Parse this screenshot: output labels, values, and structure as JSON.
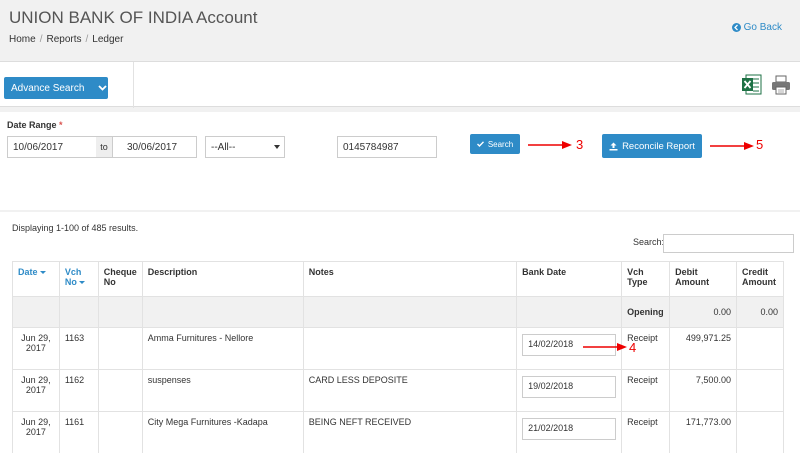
{
  "header": {
    "title": "UNION BANK OF INDIA Account",
    "breadcrumb": [
      "Home",
      "Reports",
      "Ledger"
    ],
    "go_back": "Go Back"
  },
  "toolbar": {
    "advance_search": "Advance Search",
    "excel_icon": "excel-export-icon",
    "print_icon": "printer-icon"
  },
  "filters": {
    "date_range_label": "Date Range",
    "required_mark": "*",
    "date_from": "10/06/2017",
    "to_label": "to",
    "date_to": "30/06/2017",
    "type_select": "--All--",
    "account_no": "0145784987",
    "search_button": "Search",
    "reconcile_button": "Reconcile Report"
  },
  "annotations": {
    "search_marker": "3",
    "reconcile_marker": "5",
    "bank_date_marker": "4"
  },
  "results": {
    "count_text": "Displaying 1-100 of 485 results.",
    "search_label": "Search:",
    "search_value": ""
  },
  "table": {
    "columns": {
      "date": "Date",
      "vch_no_line1": "Vch",
      "vch_no_line2": "No",
      "cheque_line1": "Cheque",
      "cheque_line2": "No",
      "description": "Description",
      "notes": "Notes",
      "bank_date": "Bank Date",
      "vch_type_line1": "Vch",
      "vch_type_line2": "Type",
      "debit_line1": "Debit",
      "debit_line2": "Amount",
      "credit_line1": "Credit",
      "credit_line2": "Amount"
    },
    "opening": {
      "label": "Opening",
      "debit": "0.00",
      "credit": "0.00"
    },
    "rows": [
      {
        "date_line1": "Jun 29,",
        "date_line2": "2017",
        "vch_no": "1163",
        "cheque_no": "",
        "description": "Amma Furnitures - Nellore",
        "notes": "",
        "bank_date": "14/02/2018",
        "vch_type": "Receipt",
        "debit": "499,971.25",
        "credit": ""
      },
      {
        "date_line1": "Jun 29,",
        "date_line2": "2017",
        "vch_no": "1162",
        "cheque_no": "",
        "description": "suspenses",
        "notes": "CARD LESS DEPOSITE",
        "bank_date": "19/02/2018",
        "vch_type": "Receipt",
        "debit": "7,500.00",
        "credit": ""
      },
      {
        "date_line1": "Jun 29,",
        "date_line2": "2017",
        "vch_no": "1161",
        "cheque_no": "",
        "description": "City Mega Furnitures -Kadapa",
        "notes": "BEING NEFT RECEIVED",
        "bank_date": "21/02/2018",
        "vch_type": "Receipt",
        "debit": "171,773.00",
        "credit": ""
      }
    ]
  },
  "colors": {
    "primary_button": "#2e8bc7",
    "annotation": "#e00000",
    "page_background": "#f1f1f1"
  }
}
